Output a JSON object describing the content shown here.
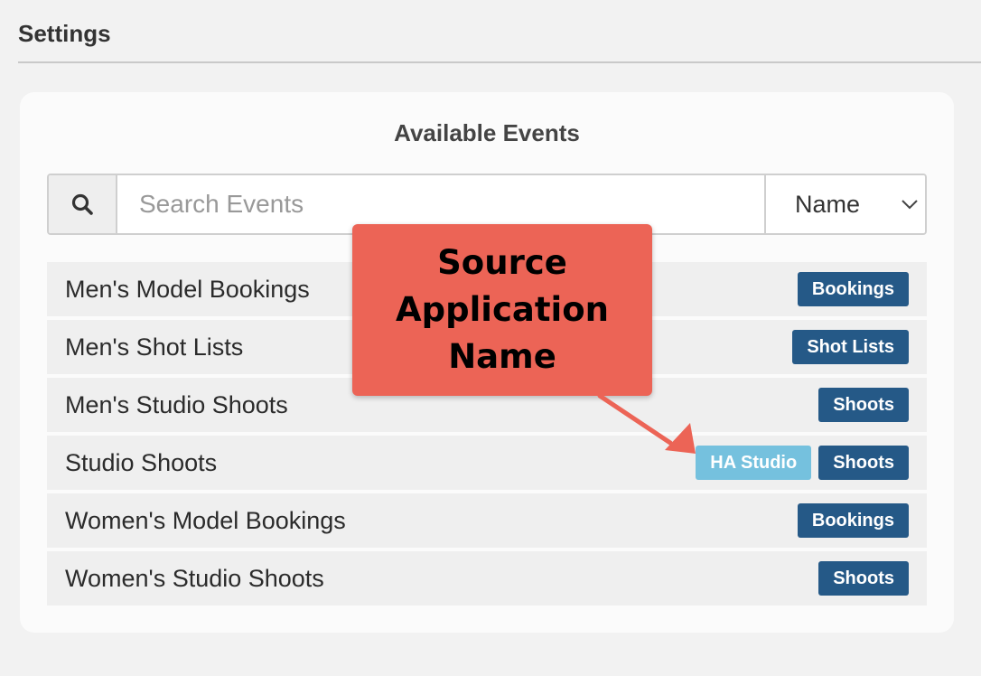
{
  "header": {
    "title": "Settings"
  },
  "panel": {
    "title": "Available Events"
  },
  "search": {
    "placeholder": "Search Events",
    "value": ""
  },
  "sort": {
    "selected": "Name"
  },
  "events": [
    {
      "name": "Men's Model Bookings",
      "source": null,
      "type": "Bookings"
    },
    {
      "name": "Men's Shot Lists",
      "source": null,
      "type": "Shot Lists"
    },
    {
      "name": "Men's Studio Shoots",
      "source": null,
      "type": "Shoots"
    },
    {
      "name": "Studio Shoots",
      "source": "HA Studio",
      "type": "Shoots"
    },
    {
      "name": "Women's Model Bookings",
      "source": null,
      "type": "Bookings"
    },
    {
      "name": "Women's Studio Shoots",
      "source": null,
      "type": "Shoots"
    }
  ],
  "annotation": {
    "lines": [
      "Source",
      "Application",
      "Name"
    ]
  },
  "colors": {
    "type_badge": "#255987",
    "source_badge": "#75c1de",
    "callout": "#ec6456"
  },
  "icons": {
    "search": "search-icon",
    "sort_dropdown": "chevron-down-icon"
  }
}
